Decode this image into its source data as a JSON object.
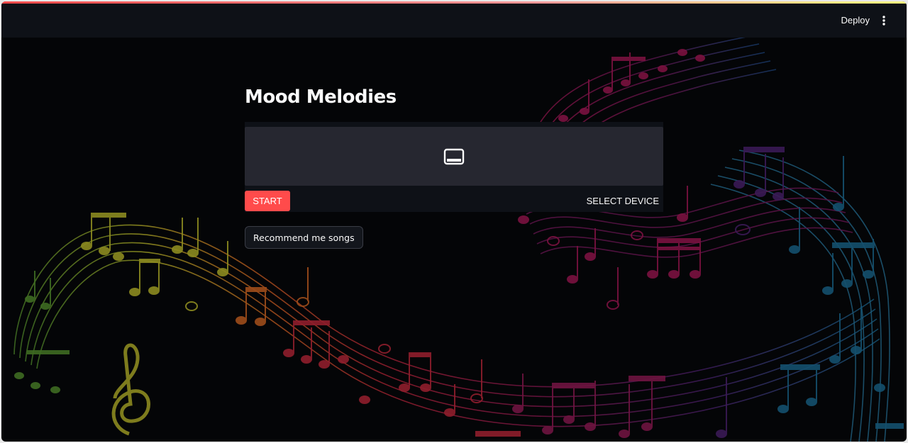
{
  "header": {
    "deploy_label": "Deploy",
    "menu_icon": "kebab-menu-icon"
  },
  "main": {
    "title": "Mood Melodies",
    "webrtc": {
      "video_icon": "video-frame-icon",
      "start_label": "START",
      "select_device_label": "SELECT DEVICE"
    },
    "recommend_label": "Recommend me songs"
  },
  "colors": {
    "accent": "#ff4b4b",
    "background": "#040507",
    "header": "#0e1117",
    "panel": "#262730",
    "text": "#fafafa"
  },
  "background_art": "music-staff-notes"
}
